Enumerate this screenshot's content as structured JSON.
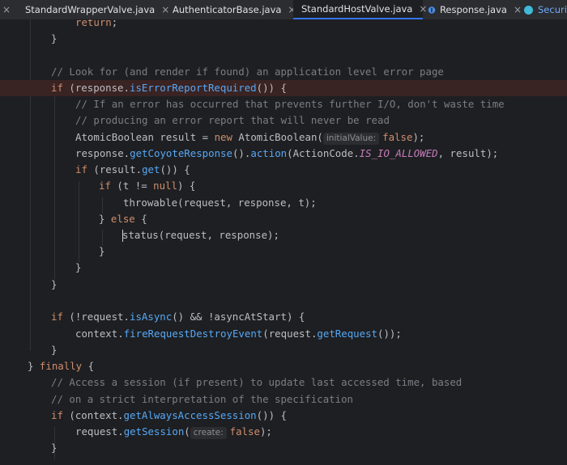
{
  "tabs": [
    {
      "label": "StandardWrapperValve.java",
      "icon": "java-class-icon",
      "close": "×",
      "active": false
    },
    {
      "label": "AuthenticatorBase.java",
      "icon": "java-abstract-class-icon",
      "close": "×",
      "active": false
    },
    {
      "label": "StandardHostValve.java",
      "icon": "java-class-icon",
      "close": "×",
      "active": true
    },
    {
      "label": "Response.java",
      "icon": "java-interface-icon",
      "close": "×",
      "active": false
    },
    {
      "label": "Security",
      "icon": "java-class-icon",
      "close": "",
      "active": false
    }
  ],
  "tab_close_left": "×",
  "colors": {
    "keyword": "#cf8e6d",
    "comment": "#7a7e85",
    "method": "#56a8f5",
    "static_field": "#c77dbb",
    "error_row": "#3a2323",
    "active_tab_underline": "#3574f0"
  },
  "code": {
    "l1": {
      "kw": "return",
      "p": ";"
    },
    "l2": {
      "p": "}"
    },
    "l4": {
      "c": "// Look for (and render if found) an application level error page"
    },
    "l5": {
      "kw": "if",
      "p1": " (response.",
      "fn": "isErrorReportRequired",
      "p2": "()) {"
    },
    "l6": {
      "c": "// If an error has occurred that prevents further I/O, don't waste time"
    },
    "l7": {
      "c": "// producing an error report that will never be read"
    },
    "l8": {
      "p1": "AtomicBoolean result = ",
      "kw": "new",
      "p2": " AtomicBoolean(",
      "hint": "initialValue:",
      "kw2": "false",
      "p3": ");"
    },
    "l9": {
      "p1": "response.",
      "fn1": "getCoyoteResponse",
      "p2": "().",
      "fn2": "action",
      "p3": "(ActionCode.",
      "st": "IS_IO_ALLOWED",
      "p4": ", result);"
    },
    "l10": {
      "kw": "if",
      "p1": " (result.",
      "fn": "get",
      "p2": "()) {"
    },
    "l11": {
      "kw": "if",
      "p1": " (t != ",
      "kw2": "null",
      "p2": ") {"
    },
    "l12": {
      "fn": "throwable",
      "p": "(request, response, t);"
    },
    "l13": {
      "p1": "} ",
      "kw": "else",
      "p2": " {"
    },
    "l14": {
      "fn": "status",
      "p": "(request, response);"
    },
    "l15": {
      "p": "}"
    },
    "l16": {
      "p": "}"
    },
    "l17": {
      "p": "}"
    },
    "l19": {
      "kw": "if",
      "p1": " (!request.",
      "fn": "isAsync",
      "p2": "() && !asyncAtStart) {"
    },
    "l20": {
      "p1": "context.",
      "fn1": "fireRequestDestroyEvent",
      "p2": "(request.",
      "fn2": "getRequest",
      "p3": "());"
    },
    "l21": {
      "p": "}"
    },
    "l22": {
      "p1": "} ",
      "kw": "finally",
      "p2": " {"
    },
    "l23": {
      "c": "// Access a session (if present) to update last accessed time, based"
    },
    "l24": {
      "c": "// on a strict interpretation of the specification"
    },
    "l25": {
      "kw": "if",
      "p1": " (context.",
      "fn": "getAlwaysAccessSession",
      "p2": "()) {"
    },
    "l26": {
      "p1": "request.",
      "fn": "getSession",
      "p2": "(",
      "hint": "create:",
      "kw2": "false",
      "p3": ");"
    },
    "l27": {
      "p": "}"
    }
  }
}
